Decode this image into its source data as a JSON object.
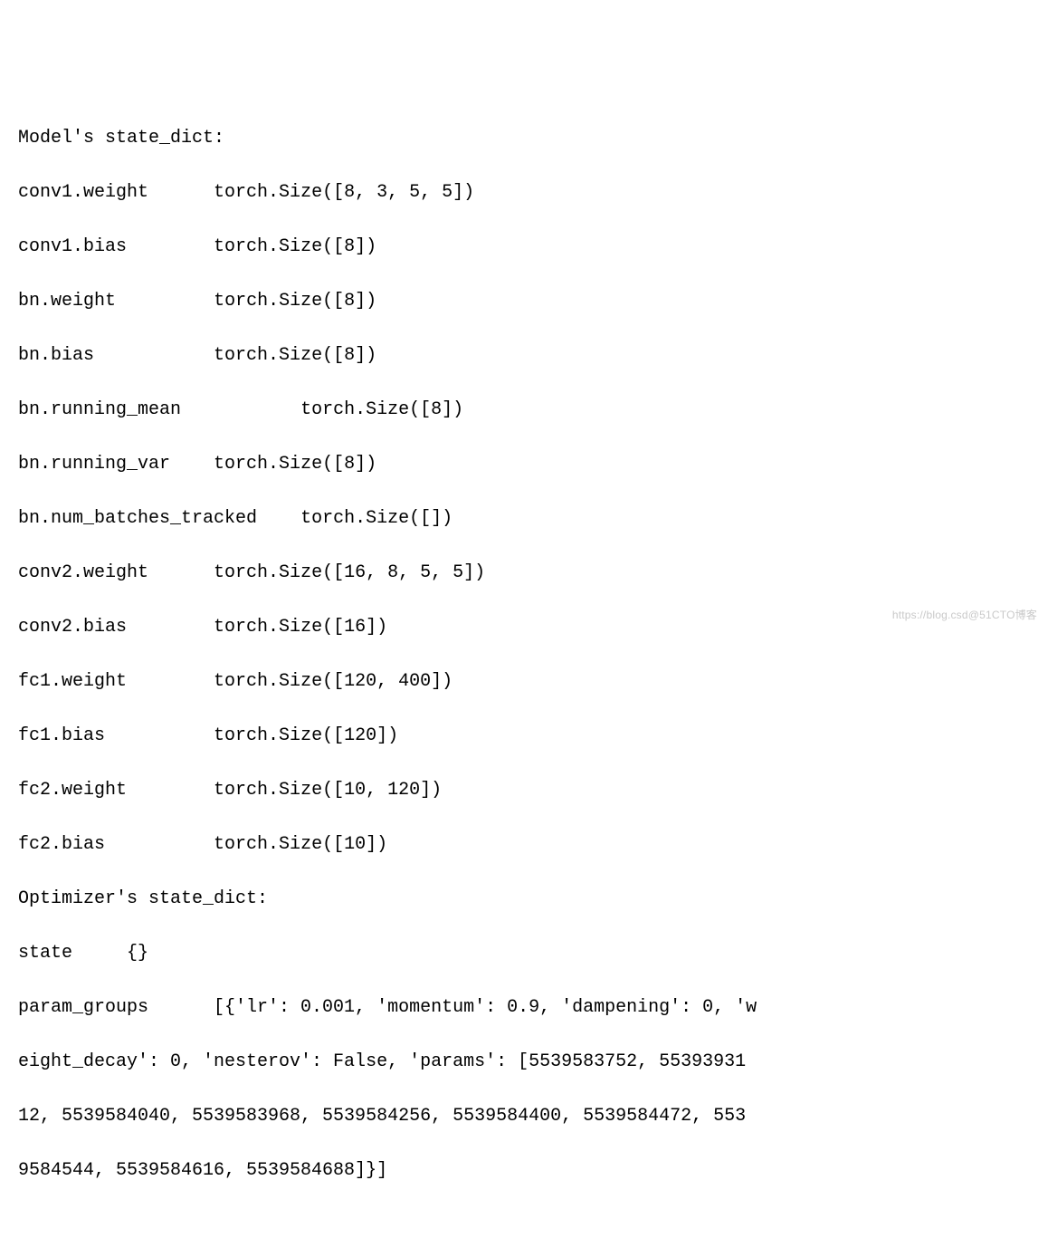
{
  "heading_model": "Model's state_dict:",
  "state_entries": [
    {
      "key": "conv1.weight",
      "pad": "      ",
      "size": "torch.Size([8, 3, 5, 5])"
    },
    {
      "key": "conv1.bias",
      "pad": "        ",
      "size": "torch.Size([8])"
    },
    {
      "key": "bn.weight",
      "pad": "         ",
      "size": "torch.Size([8])"
    },
    {
      "key": "bn.bias",
      "pad": "           ",
      "size": "torch.Size([8])"
    },
    {
      "key": "bn.running_mean",
      "pad": "           ",
      "size": "torch.Size([8])"
    },
    {
      "key": "bn.running_var",
      "pad": "    ",
      "size": "torch.Size([8])"
    },
    {
      "key": "bn.num_batches_tracked",
      "pad": "    ",
      "size": "torch.Size([])"
    },
    {
      "key": "conv2.weight",
      "pad": "      ",
      "size": "torch.Size([16, 8, 5, 5])"
    },
    {
      "key": "conv2.bias",
      "pad": "        ",
      "size": "torch.Size([16])"
    },
    {
      "key": "fc1.weight",
      "pad": "        ",
      "size": "torch.Size([120, 400])"
    },
    {
      "key": "fc1.bias",
      "pad": "          ",
      "size": "torch.Size([120])"
    },
    {
      "key": "fc2.weight",
      "pad": "        ",
      "size": "torch.Size([10, 120])"
    },
    {
      "key": "fc2.bias",
      "pad": "          ",
      "size": "torch.Size([10])"
    }
  ],
  "heading_optimizer": "Optimizer's state_dict:",
  "optimizer_state_line": "state     {}",
  "param_groups_lines": [
    "param_groups      [{'lr': 0.001, 'momentum': 0.9, 'dampening': 0, 'w",
    "eight_decay': 0, 'nesterov': False, 'params': [5539583752, 55393931",
    "12, 5539584040, 5539583968, 5539584256, 5539584400, 5539584472, 553",
    "9584544, 5539584616, 5539584688]}]"
  ],
  "watermark": "https://blog.csd@51CTO博客"
}
